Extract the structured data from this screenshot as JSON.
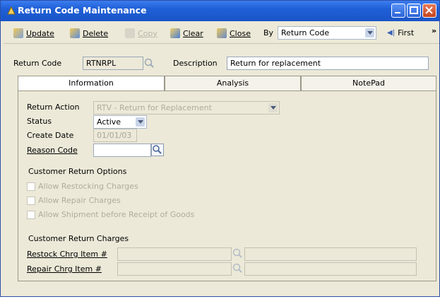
{
  "window": {
    "title": "Return Code Maintenance"
  },
  "toolbar": {
    "update_label": "Update",
    "delete_label": "Delete",
    "copy_label": "Copy",
    "clear_label": "Clear",
    "close_label": "Close",
    "by_label": "By",
    "by_value": "Return Code",
    "first_label": "First",
    "more_label": "»"
  },
  "header": {
    "return_code_label": "Return Code",
    "return_code_value": "RTNRPL",
    "description_label": "Description",
    "description_value": "Return for replacement"
  },
  "tabs": [
    {
      "label": "Information"
    },
    {
      "label": "Analysis"
    },
    {
      "label": "NotePad"
    }
  ],
  "info": {
    "return_action_label": "Return Action",
    "return_action_value": "RTV - Return for Replacement",
    "status_label": "Status",
    "status_value": "Active",
    "create_date_label": "Create Date",
    "create_date_value": "01/01/03",
    "reason_code_label": "Reason Code",
    "reason_code_value": "",
    "options_heading": "Customer Return Options",
    "options": [
      {
        "label": "Allow Restocking Charges"
      },
      {
        "label": "Allow Repair Charges"
      },
      {
        "label": "Allow Shipment before Receipt of Goods"
      }
    ],
    "charges_heading": "Customer Return Charges",
    "restock_label": "Restock Chrg Item #",
    "repair_label": "Repair Chrg Item #"
  },
  "colors": {
    "titlebar": "#1f5fd6",
    "window_bg": "#ece9d8"
  }
}
